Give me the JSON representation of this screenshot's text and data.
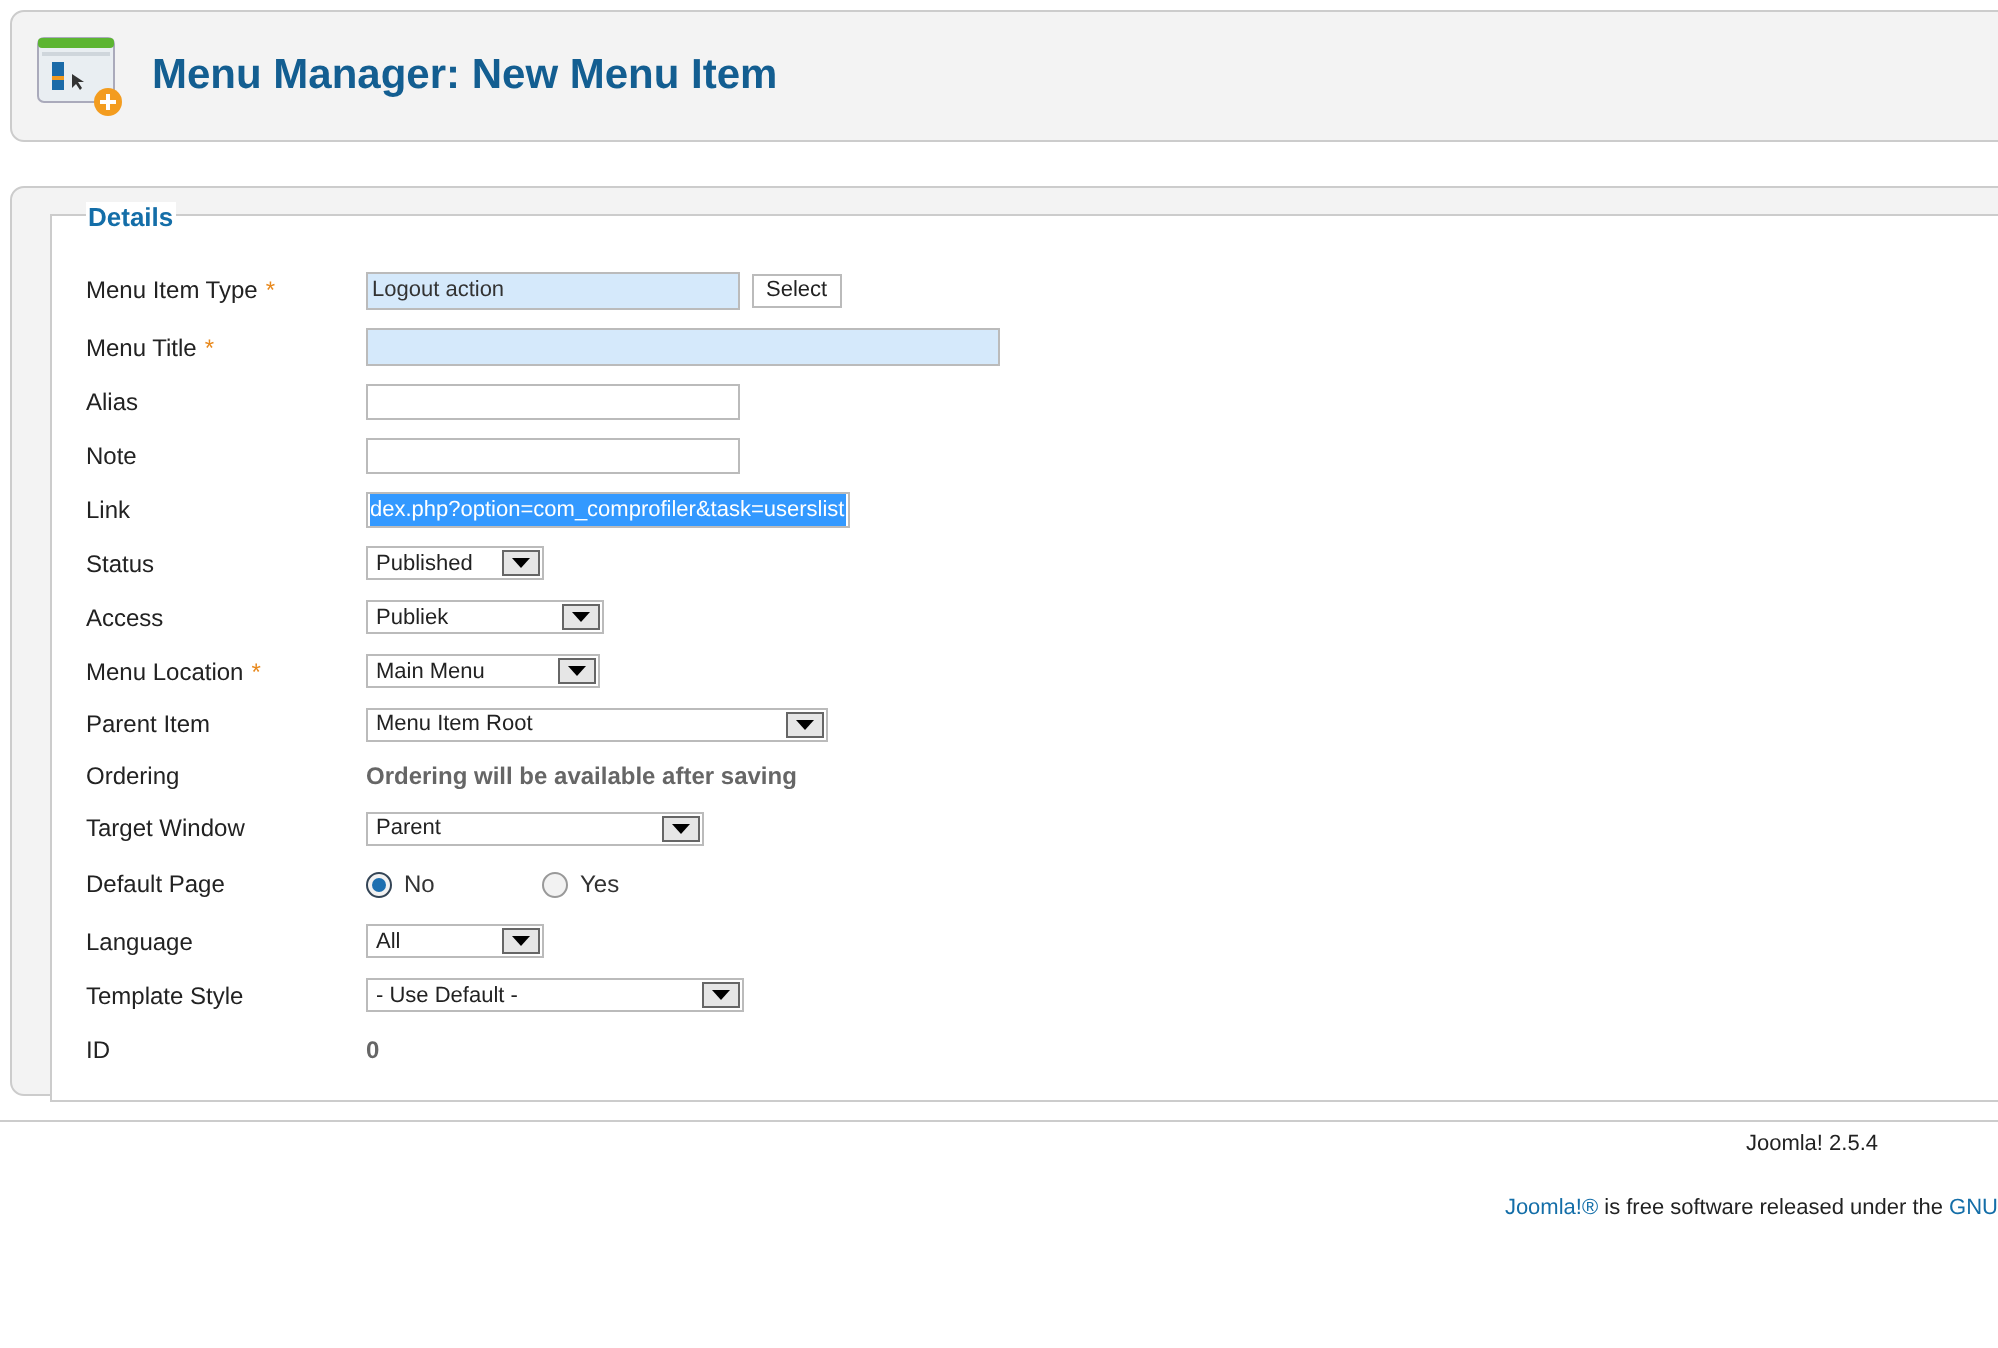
{
  "header": {
    "title": "Menu Manager: New Menu Item"
  },
  "details": {
    "legend": "Details",
    "fields": [
      {
        "label": "Menu Item Type",
        "required_mark": "*",
        "kind": "text",
        "highlighted": true,
        "value": "Logout action",
        "button": "Select"
      },
      {
        "label": "Menu Title",
        "required_mark": "*",
        "kind": "text",
        "highlighted": true
      },
      {
        "label": "Alias",
        "kind": "text",
        "highlighted": false
      },
      {
        "label": "Note",
        "kind": "text",
        "highlighted": false
      },
      {
        "label": "Link",
        "kind": "text",
        "highlighted": false,
        "value": "dex.php?option=com_comprofiler&task=userslist",
        "value_selected": true
      },
      {
        "label": "Status",
        "kind": "select",
        "value": "Published"
      },
      {
        "label": "Access",
        "kind": "select",
        "value": "Publiek"
      },
      {
        "label": "Menu Location",
        "required_mark": "*",
        "kind": "select",
        "value": "Main Menu"
      },
      {
        "label": "Parent Item",
        "kind": "select",
        "value": "Menu Item Root"
      },
      {
        "label": "Ordering",
        "kind": "static",
        "value": "Ordering will be available after saving"
      },
      {
        "label": "Target Window",
        "kind": "select",
        "value": "Parent"
      },
      {
        "label": "Default Page",
        "kind": "radio",
        "options": [
          {
            "label": "No",
            "selected": true
          },
          {
            "label": "Yes",
            "selected": false
          }
        ]
      },
      {
        "label": "Language",
        "kind": "select",
        "value": "All"
      },
      {
        "label": "Template Style",
        "kind": "select",
        "value": "- Use Default -"
      },
      {
        "label": "ID",
        "kind": "static",
        "value": "0"
      }
    ]
  },
  "footer": {
    "version": "Joomla! 2.5.4",
    "license": [
      {
        "kind": "link",
        "text": "Joomla!®"
      },
      {
        "kind": "text",
        "text": " is free software released under the "
      },
      {
        "kind": "link",
        "text": "GNU"
      }
    ]
  }
}
